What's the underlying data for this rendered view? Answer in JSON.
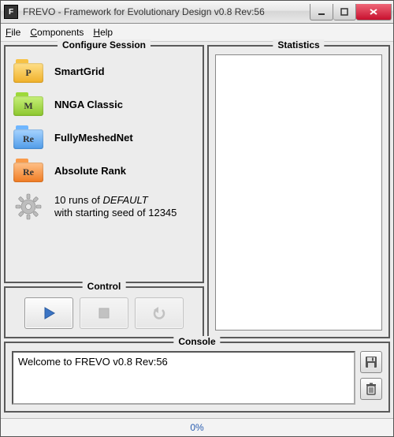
{
  "window": {
    "title": "FREVO - Framework for Evolutionary Design v0.8 Rev:56",
    "app_icon_letter": "F"
  },
  "menubar": {
    "file": "File",
    "components": "Components",
    "help": "Help"
  },
  "panels": {
    "configure": "Configure Session",
    "statistics": "Statistics",
    "control": "Control",
    "console": "Console"
  },
  "session": {
    "items": [
      {
        "label": "SmartGrid",
        "icon_text": "P",
        "icon_color": "yellow"
      },
      {
        "label": "NNGA Classic",
        "icon_text": "M",
        "icon_color": "green"
      },
      {
        "label": "FullyMeshedNet",
        "icon_text": "Re",
        "icon_color": "blue"
      },
      {
        "label": "Absolute Rank",
        "icon_text": "Re",
        "icon_color": "orange"
      }
    ],
    "runs_line1_prefix": "10 runs of ",
    "runs_line1_emph": "DEFAULT",
    "runs_line2": "with starting seed of 12345"
  },
  "console": {
    "text": "Welcome to FREVO v0.8 Rev:56"
  },
  "progress": {
    "label": "0%"
  }
}
